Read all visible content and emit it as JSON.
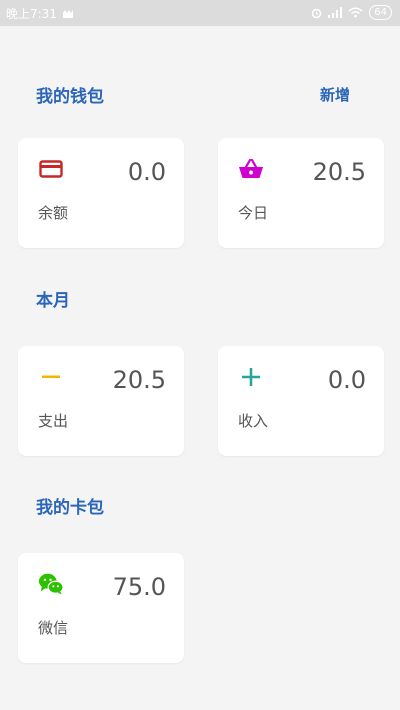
{
  "status_bar": {
    "time": "晚上7:31",
    "battery": "64"
  },
  "wallet": {
    "title": "我的钱包",
    "add_label": "新增",
    "balance": {
      "value": "0.0",
      "label": "余额",
      "icon": "credit-card-icon",
      "color": "#c62828"
    },
    "today": {
      "value": "20.5",
      "label": "今日",
      "icon": "basket-icon",
      "color": "#d000d0"
    }
  },
  "month": {
    "title": "本月",
    "expense": {
      "value": "20.5",
      "label": "支出",
      "icon": "minus-icon",
      "color": "#f4b400"
    },
    "income": {
      "value": "0.0",
      "label": "收入",
      "icon": "plus-icon",
      "color": "#26a69a"
    }
  },
  "cards": {
    "title": "我的卡包",
    "wechat": {
      "value": "75.0",
      "label": "微信",
      "icon": "wechat-icon",
      "color": "#2dc100"
    }
  },
  "colors": {
    "accent": "#2b66b8",
    "background": "#f4f4f4",
    "card": "#ffffff"
  }
}
